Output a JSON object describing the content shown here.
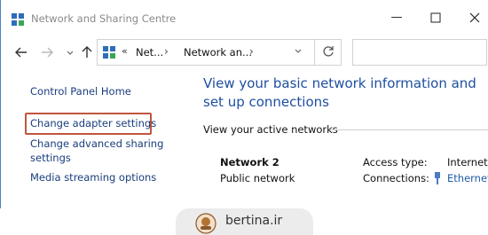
{
  "window": {
    "title": "Network and Sharing Centre",
    "controls": {
      "minimize_icon": "minimize-icon",
      "maximize_icon": "maximize-icon",
      "close_icon": "close-icon"
    }
  },
  "navigation": {
    "back_icon": "back-arrow-icon",
    "forward_icon": "forward-arrow-icon",
    "recent_icon": "chevron-down-icon",
    "up_icon": "up-arrow-icon",
    "address": {
      "overflow": "«",
      "segments": [
        "Net...",
        "Network an..."
      ],
      "separator": "›",
      "refresh_icon": "refresh-icon"
    },
    "search": {
      "placeholder": ""
    }
  },
  "sidebar": {
    "items": [
      {
        "label": "Control Panel Home"
      },
      {
        "label": "Change adapter settings",
        "highlighted": true
      },
      {
        "label": "Change advanced sharing",
        "label_cont": "settings"
      },
      {
        "label": "Media streaming options"
      }
    ]
  },
  "main": {
    "heading": "View your basic network information and set up connections",
    "active_networks_label": "View your active networks",
    "network": {
      "name": "Network 2",
      "type": "Public network",
      "access_type_label": "Access type:",
      "access_type_value": "Internet",
      "connections_label": "Connections:",
      "connections_value": "Ethernet"
    }
  },
  "watermark": {
    "text": "bertina.ir"
  },
  "colors": {
    "link": "#1a3d7c",
    "heading": "#1e4fa0",
    "highlight_border": "#c0553f",
    "window_border": "#4a86c5"
  }
}
